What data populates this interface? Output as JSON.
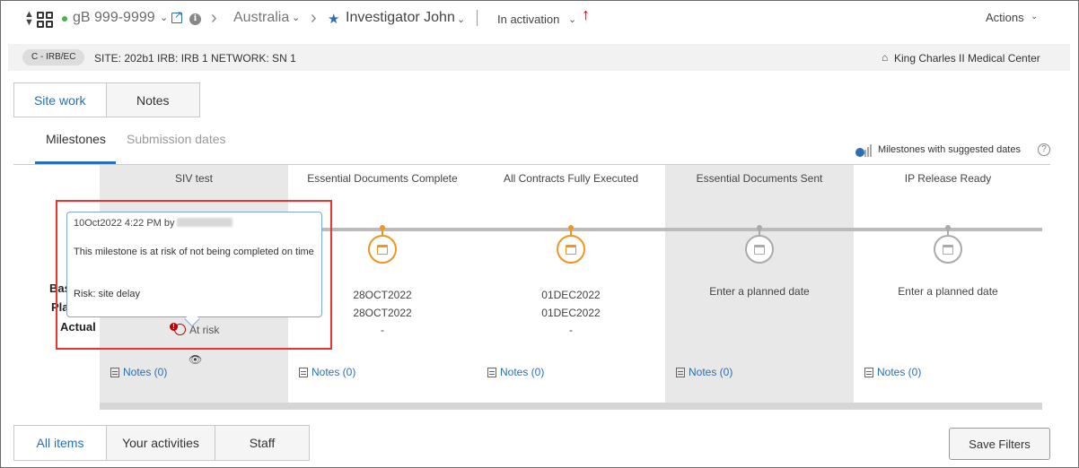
{
  "header": {
    "study_id": "gB 999-9999",
    "country": "Australia",
    "investigator": "Investigator John",
    "status": "In activation",
    "actions_label": "Actions"
  },
  "subheader": {
    "badge": "C - IRB/EC",
    "site_info": "SITE: 202b1  IRB: IRB 1  NETWORK: SN 1",
    "center_name": "King Charles II Medical Center"
  },
  "top_tabs": [
    {
      "label": "Site work",
      "active": true
    },
    {
      "label": "Notes",
      "active": false
    }
  ],
  "sub_tabs": [
    {
      "label": "Milestones",
      "active": true
    },
    {
      "label": "Submission dates",
      "active": false
    }
  ],
  "suggested_label": "Milestones with suggested dates",
  "row_labels": {
    "baseline": "Bas",
    "planned": "Pla",
    "actual": "Actual"
  },
  "milestones": [
    {
      "title": "SIV test",
      "status": "At risk",
      "notes": "Notes (0)"
    },
    {
      "title": "Essential Documents Complete",
      "baseline": "28OCT2022",
      "planned": "28OCT2022",
      "actual": "-",
      "notes": "Notes (0)"
    },
    {
      "title": "All Contracts Fully Executed",
      "baseline": "01DEC2022",
      "planned": "01DEC2022",
      "actual": "-",
      "notes": "Notes (0)"
    },
    {
      "title": "Essential Documents Sent",
      "placeholder": "Enter a planned date",
      "notes": "Notes (0)"
    },
    {
      "title": "IP Release Ready",
      "placeholder": "Enter a planned date",
      "notes": "Notes (0)"
    }
  ],
  "popup": {
    "meta": "10Oct2022 4:22 PM by",
    "message": "This milestone is at risk of not being completed on time",
    "risk": "Risk: site delay"
  },
  "bottom_tabs": [
    {
      "label": "All items",
      "active": true
    },
    {
      "label": "Your activities",
      "active": false
    },
    {
      "label": "Staff",
      "active": false
    }
  ],
  "save_filters_label": "Save Filters",
  "colors": {
    "accent": "#2a6fb5",
    "warning": "#f0961e",
    "risk": "#c00000"
  }
}
